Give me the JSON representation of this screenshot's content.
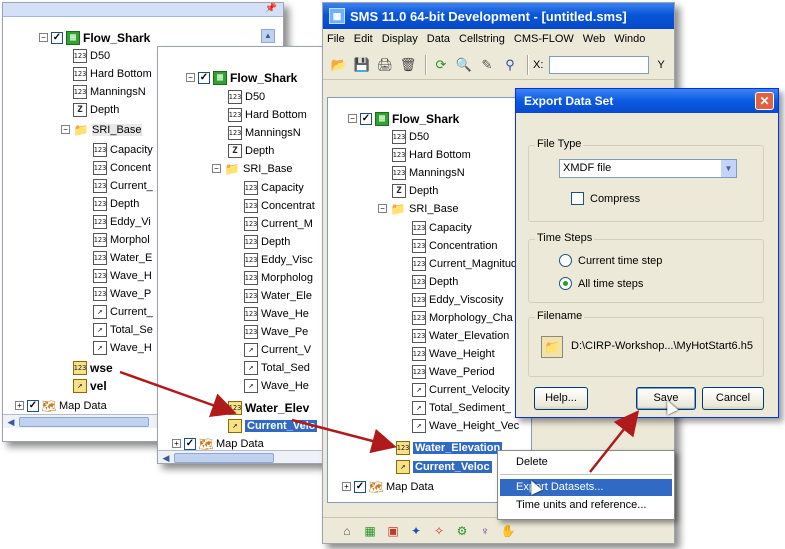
{
  "panel1": {
    "nodes": [
      {
        "label": "Flow_Shark",
        "icon": "grid-icon"
      },
      {
        "label": "D50",
        "icon": "123"
      },
      {
        "label": "Hard Bottom",
        "icon": "123"
      },
      {
        "label": "ManningsN",
        "icon": "123"
      },
      {
        "label": "Depth",
        "icon": "Z"
      },
      {
        "label": "SRI_Base",
        "icon": "folder"
      },
      {
        "label": "Capacity",
        "icon": "123"
      },
      {
        "label": "Concent",
        "icon": "123"
      },
      {
        "label": "Current_",
        "icon": "123"
      },
      {
        "label": "Depth",
        "icon": "123"
      },
      {
        "label": "Eddy_Vi",
        "icon": "123"
      },
      {
        "label": "Morphol",
        "icon": "123"
      },
      {
        "label": "Water_E",
        "icon": "123"
      },
      {
        "label": "Wave_H",
        "icon": "123"
      },
      {
        "label": "Wave_P",
        "icon": "123"
      },
      {
        "label": "Current_",
        "icon": "vec"
      },
      {
        "label": "Total_Se",
        "icon": "vec"
      },
      {
        "label": "Wave_H",
        "icon": "vec"
      },
      {
        "label": "wse",
        "icon": "123"
      },
      {
        "label": "vel",
        "icon": "vec"
      },
      {
        "label": "Map Data",
        "icon": "map"
      }
    ]
  },
  "panel2": {
    "nodes": [
      {
        "label": "Flow_Shark"
      },
      {
        "label": "D50"
      },
      {
        "label": "Hard Bottom"
      },
      {
        "label": "ManningsN"
      },
      {
        "label": "Depth"
      },
      {
        "label": "SRI_Base"
      },
      {
        "label": "Capacity"
      },
      {
        "label": "Concentrat"
      },
      {
        "label": "Current_M"
      },
      {
        "label": "Depth"
      },
      {
        "label": "Eddy_Visc"
      },
      {
        "label": "Morpholog"
      },
      {
        "label": "Water_Ele"
      },
      {
        "label": "Wave_He"
      },
      {
        "label": "Wave_Pe"
      },
      {
        "label": "Current_V"
      },
      {
        "label": "Total_Sed"
      },
      {
        "label": "Wave_He"
      },
      {
        "label": "Water_Elev"
      },
      {
        "label": "Current_Velo"
      },
      {
        "label": "Map Data"
      }
    ]
  },
  "main_window": {
    "title": "SMS 11.0 64-bit Development - [untitled.sms]",
    "menu": [
      "File",
      "Edit",
      "Display",
      "Data",
      "Cellstring",
      "CMS-FLOW",
      "Web",
      "Windo"
    ],
    "toolbar_x_label": "X:",
    "toolbar_y_label": "Y",
    "tree": [
      {
        "label": "Flow_Shark"
      },
      {
        "label": "D50"
      },
      {
        "label": "Hard Bottom"
      },
      {
        "label": "ManningsN"
      },
      {
        "label": "Depth"
      },
      {
        "label": "SRI_Base"
      },
      {
        "label": "Capacity"
      },
      {
        "label": "Concentration"
      },
      {
        "label": "Current_Magnitud"
      },
      {
        "label": "Depth"
      },
      {
        "label": "Eddy_Viscosity"
      },
      {
        "label": "Morphology_Cha"
      },
      {
        "label": "Water_Elevation"
      },
      {
        "label": "Wave_Height"
      },
      {
        "label": "Wave_Period"
      },
      {
        "label": "Current_Velocity"
      },
      {
        "label": "Total_Sediment_"
      },
      {
        "label": "Wave_Height_Vec"
      },
      {
        "label": "Water_Elevation"
      },
      {
        "label": "Current_Veloc"
      },
      {
        "label": "Map Data"
      }
    ]
  },
  "dialog": {
    "title": "Export Data Set",
    "file_type_group": "File Type",
    "file_type_value": "XMDF file",
    "compress_label": "Compress",
    "time_steps_group": "Time Steps",
    "current_time_step_label": "Current time step",
    "all_time_steps_label": "All time steps",
    "filename_group": "Filename",
    "filename_value": "D:\\CIRP-Workshop...\\MyHotStart6.h5",
    "help_label": "Help...",
    "save_label": "Save",
    "cancel_label": "Cancel"
  },
  "context_menu": {
    "items": [
      "Delete",
      "Export Datasets...",
      "Time units and reference..."
    ]
  },
  "colors": {
    "selection": "#316ac5",
    "arrow": "#b11a1a",
    "titlebar": "#0a56d8"
  }
}
